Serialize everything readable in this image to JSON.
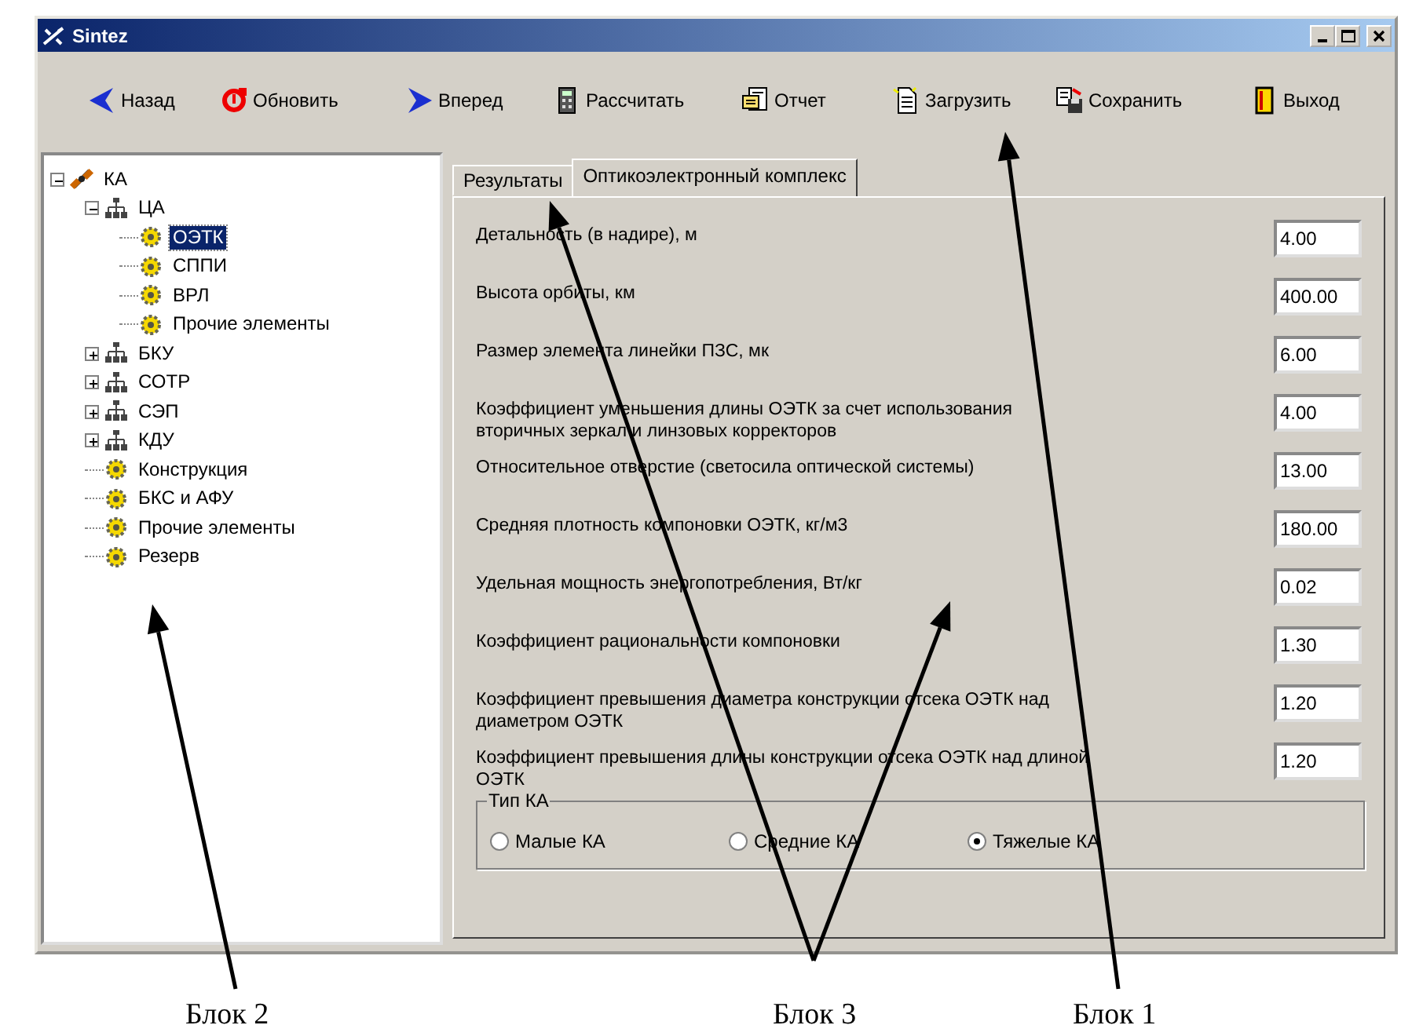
{
  "window": {
    "title": "Sintez"
  },
  "toolbar": [
    {
      "kind": "back",
      "label": "Назад"
    },
    {
      "kind": "refresh",
      "label": "Обновить"
    },
    {
      "kind": "forward",
      "label": "Вперед"
    },
    {
      "kind": "calculate",
      "label": "Рассчитать"
    },
    {
      "kind": "report",
      "label": "Отчет"
    },
    {
      "kind": "load",
      "label": "Загрузить"
    },
    {
      "kind": "save",
      "label": "Сохранить"
    },
    {
      "kind": "exit",
      "label": "Выход"
    }
  ],
  "tree": [
    {
      "kind": "root",
      "label": "КА",
      "expanded": true,
      "selected": false,
      "children": [
        {
          "kind": "group",
          "label": "ЦА",
          "expanded": true,
          "selected": false,
          "children": [
            {
              "kind": "element",
              "label": "ОЭТК",
              "selected": true
            },
            {
              "kind": "element",
              "label": "СППИ",
              "selected": false
            },
            {
              "kind": "element",
              "label": "ВРЛ",
              "selected": false
            },
            {
              "kind": "element",
              "label": "Прочие элементы",
              "selected": false
            }
          ]
        },
        {
          "kind": "group",
          "label": "БКУ",
          "expanded": false,
          "selected": false
        },
        {
          "kind": "group",
          "label": "СОТР",
          "expanded": false,
          "selected": false
        },
        {
          "kind": "group",
          "label": "СЭП",
          "expanded": false,
          "selected": false
        },
        {
          "kind": "group",
          "label": "КДУ",
          "expanded": false,
          "selected": false
        },
        {
          "kind": "element",
          "label": "Конструкция",
          "selected": false
        },
        {
          "kind": "element",
          "label": "БКС и АФУ",
          "selected": false
        },
        {
          "kind": "element",
          "label": "Прочие элементы",
          "selected": false
        },
        {
          "kind": "element",
          "label": "Резерв",
          "selected": false
        }
      ]
    }
  ],
  "tabs": [
    {
      "label": "Результаты",
      "selected": false
    },
    {
      "label": "Оптикоэлектронный комплекс",
      "selected": true
    }
  ],
  "fields": [
    {
      "label": "Детальность (в надире), м",
      "value": "4.00"
    },
    {
      "label": "Высота орбиты, км",
      "value": "400.00"
    },
    {
      "label": "Размер элемента линейки ПЗС, мк",
      "value": "6.00"
    },
    {
      "label": "Коэффициент уменьшения длины ОЭТК за счет использования вторичных зеркал и линзовых корректоров",
      "value": "4.00"
    },
    {
      "label": "Относительное отверстие (светосила оптической системы)",
      "value": "13.00"
    },
    {
      "label": "Средняя плотность компоновки ОЭТК, кг/м3",
      "value": "180.00"
    },
    {
      "label": "Удельная мощность энергопотребления, Вт/кг",
      "value": "0.02"
    },
    {
      "label": "Коэффициент рациональности компоновки",
      "value": "1.30"
    },
    {
      "label": "Коэффициент превышения диаметра конструкции отсека ОЭТК над диаметром ОЭТК",
      "value": "1.20"
    },
    {
      "label": "Коэффициент превышения длины конструкции отсека ОЭТК над длиной ОЭТК",
      "value": "1.20"
    }
  ],
  "type_group": {
    "title": "Тип КА",
    "options": [
      {
        "label": "Малые КА",
        "selected": false
      },
      {
        "label": "Средние КА",
        "selected": false
      },
      {
        "label": "Тяжелые КА",
        "selected": true
      }
    ]
  },
  "annotations": [
    {
      "label": "Блок 2"
    },
    {
      "label": "Блок 3"
    },
    {
      "label": "Блок 1"
    }
  ]
}
